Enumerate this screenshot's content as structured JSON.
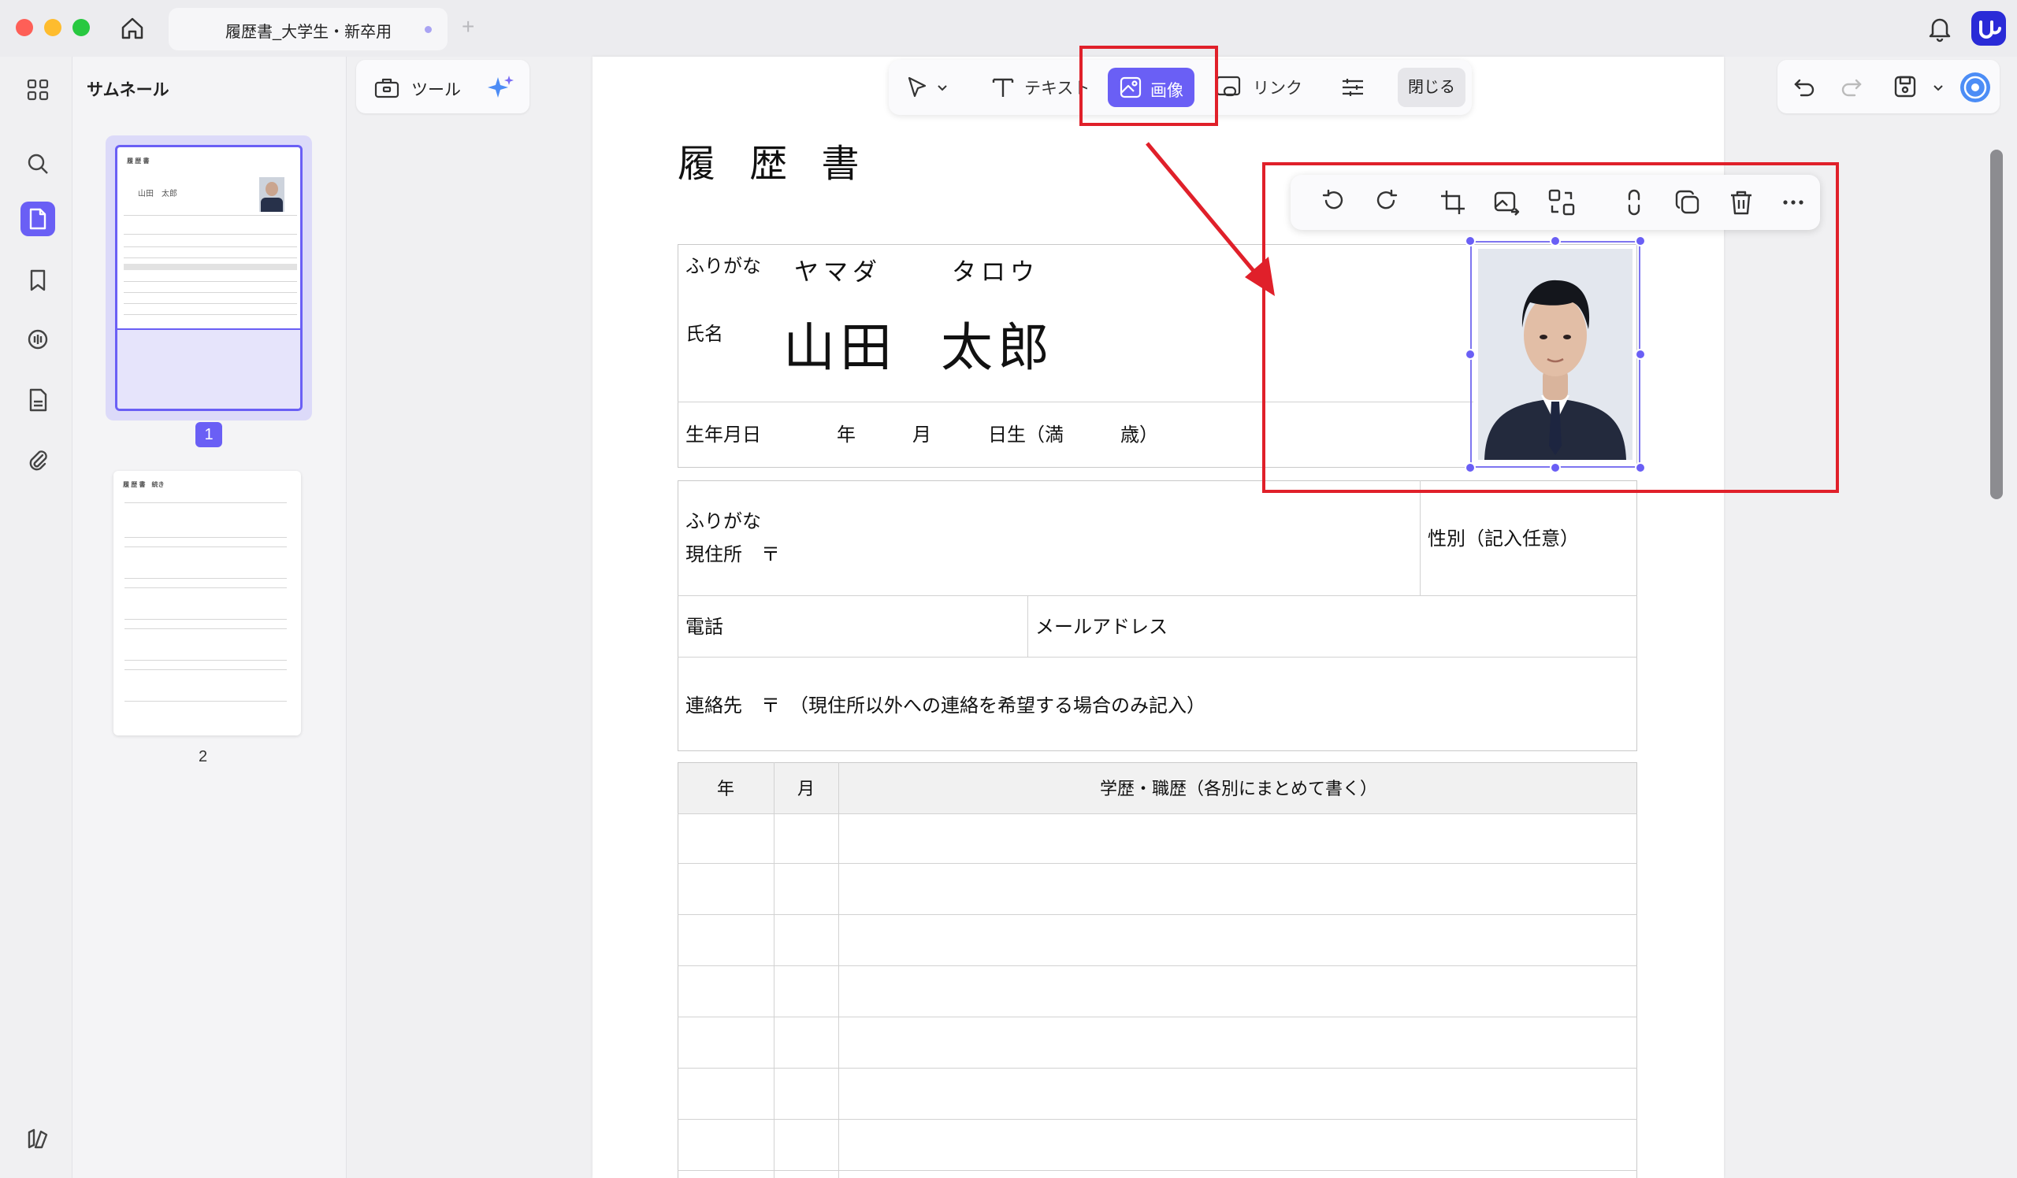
{
  "tab": {
    "title": "履歴書_大学生・新卒用",
    "new_tab": "+"
  },
  "thumbnails": {
    "header": "サムネール",
    "page1_number": "1",
    "page2_number": "2",
    "page1_mini": {
      "title": "履 歴 書",
      "name": "山田　太郎"
    },
    "page2_mini": {
      "title": "履 歴 書　続き"
    }
  },
  "tools_label": "ツール",
  "edit_toolbar": {
    "text": "テキスト",
    "image": "画像",
    "link": "リンク",
    "close": "閉じる"
  },
  "document": {
    "title": "履 歴 書",
    "furigana_label": "ふりがな",
    "furigana_surname": "ヤマダ",
    "furigana_given": "タロウ",
    "name_label": "氏名",
    "surname": "山田",
    "given_name": "太郎",
    "birth_label": "生年月日",
    "year_char": "年",
    "month_char": "月",
    "birth_suffix": "日生（満",
    "age_suffix": "歳）",
    "address_furigana": "ふりがな",
    "address_label": "現住所　〒",
    "gender_label": "性別（記入任意）",
    "phone_label": "電話",
    "email_label": "メールアドレス",
    "contact_label": "連絡先　〒　（現住所以外への連絡を希望する場合のみ記入）",
    "history_headers": [
      "年",
      "月",
      "学歴・職歴（各別にまとめて書く）"
    ]
  },
  "colors": {
    "accent": "#6a5ff5",
    "highlight": "#e0202a"
  }
}
